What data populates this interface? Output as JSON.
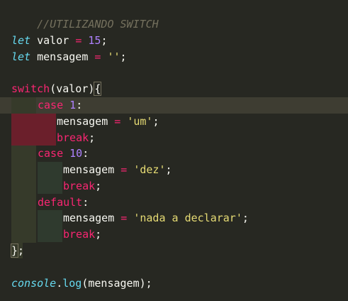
{
  "editor": {
    "comment": "//UTILIZANDO SWITCH",
    "line1": {
      "kw": "let",
      "name": " valor ",
      "op": "=",
      "sp": " ",
      "num": "15",
      "end": ";"
    },
    "line2": {
      "kw": "let",
      "name": " mensagem ",
      "op": "=",
      "sp": " ",
      "str": "''",
      "end": ";"
    },
    "sw": {
      "kw": "switch",
      "open": "(",
      "arg": "valor",
      "close": ")",
      "brace": "{"
    },
    "case1": {
      "kw": "case",
      "sp": " ",
      "num": "1",
      "colon": ":"
    },
    "assign1": {
      "name": "mensagem ",
      "op": "=",
      "sp": " ",
      "str": "'um'",
      "end": ";"
    },
    "break1": {
      "kw": "break",
      "end": ";"
    },
    "case2": {
      "kw": "case",
      "sp": " ",
      "num": "10",
      "colon": ":"
    },
    "assign2": {
      "name": "mensagem ",
      "op": "=",
      "sp": " ",
      "str": "'dez'",
      "end": ";"
    },
    "break2": {
      "kw": "break",
      "end": ";"
    },
    "def": {
      "kw": "default",
      "colon": ":"
    },
    "assign3": {
      "name": "mensagem ",
      "op": "=",
      "sp": " ",
      "str": "'nada a declarar'",
      "end": ";"
    },
    "break3": {
      "kw": "break",
      "end": ";"
    },
    "closing": {
      "brace": "}",
      "end": ";"
    },
    "log": {
      "obj": "console",
      "dot": ".",
      "fn": "log",
      "open": "(",
      "arg": "mensagem",
      "close": ")",
      "end": ";"
    }
  },
  "colors": {
    "background": "#272822",
    "keyword": "#f92672",
    "storage": "#66d9ef",
    "number": "#ae81ff",
    "string": "#e6db74",
    "comment": "#75715e",
    "indent_guide_dark": "#3a3b2a",
    "error_highlight": "#6b1f2b"
  }
}
